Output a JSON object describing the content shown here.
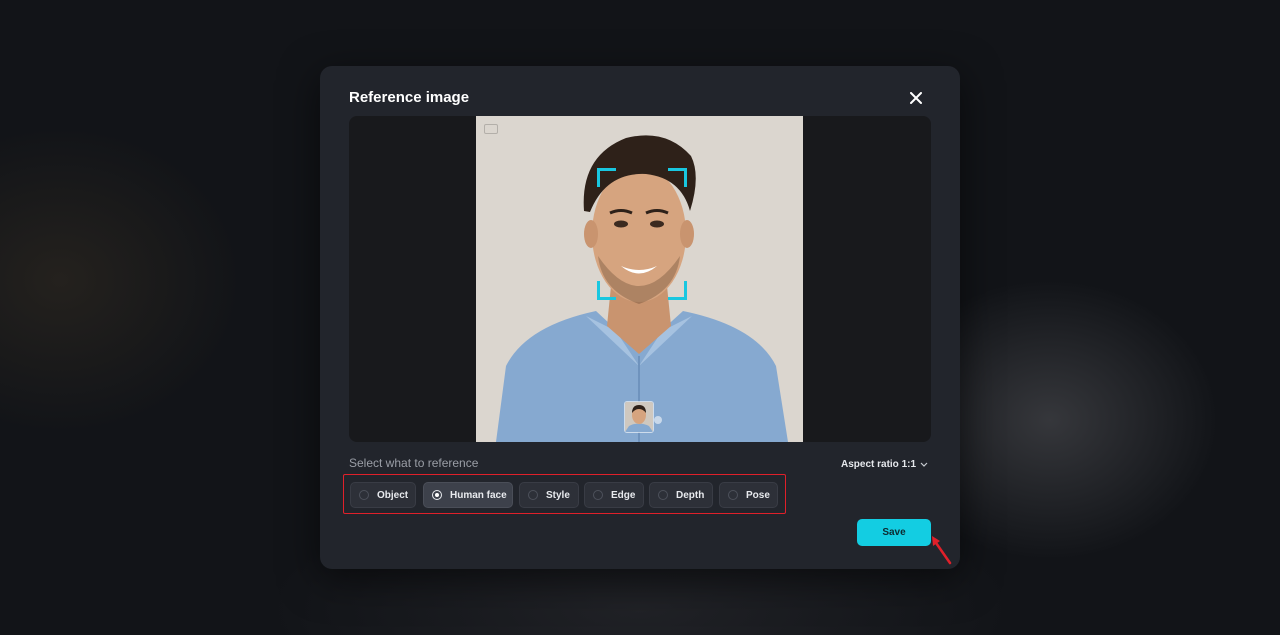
{
  "dialog": {
    "title": "Reference image"
  },
  "reference": {
    "section_label": "Select what to reference",
    "aspect_ratio_label": "Aspect ratio 1:1",
    "options": [
      {
        "label": "Object",
        "selected": false
      },
      {
        "label": "Human face",
        "selected": true
      },
      {
        "label": "Style",
        "selected": false
      },
      {
        "label": "Edge",
        "selected": false
      },
      {
        "label": "Depth",
        "selected": false
      },
      {
        "label": "Pose",
        "selected": false
      }
    ]
  },
  "actions": {
    "save_label": "Save"
  },
  "icons": {
    "close": "close-icon",
    "chevron": "chevron-down-icon",
    "cursor": "arrow-annotation-icon"
  },
  "colors": {
    "accent": "#13cde2",
    "face_frame": "#19c7e0",
    "highlight": "#e0202a"
  }
}
